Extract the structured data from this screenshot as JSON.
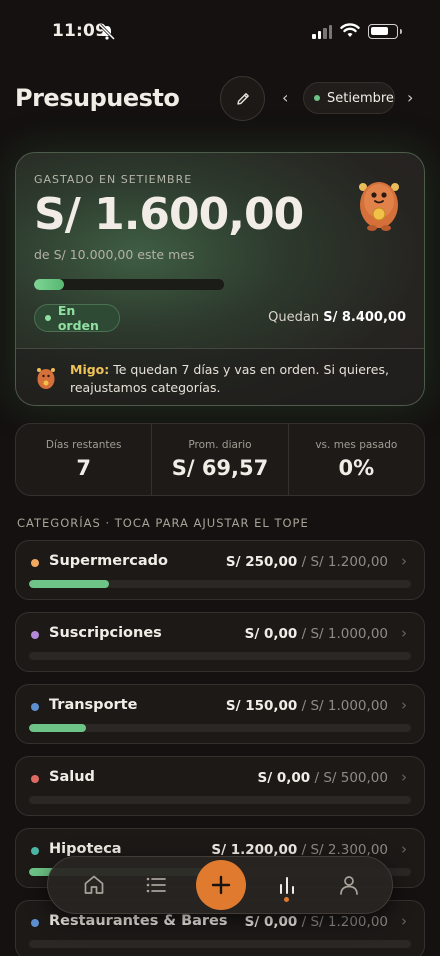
{
  "status": {
    "time": "11:09"
  },
  "header": {
    "title": "Presupuesto",
    "month": "Setiembre",
    "prev": "‹",
    "next": "›"
  },
  "summary": {
    "label": "GASTADO EN SETIEMBRE",
    "amount": "S/ 1.600,00",
    "of_total": "de S/ 10.000,00 este mes",
    "progress": 0.16,
    "status": "En orden",
    "remaining_label": "Quedan",
    "remaining_value": "S/ 8.400,00",
    "migo_name": "Migo:",
    "migo_message": "Te quedan 7 días y vas en orden. Si quieres, reajustamos categorías."
  },
  "stats": [
    {
      "label": "Días restantes",
      "value": "7"
    },
    {
      "label": "Prom. diario",
      "value": "S/ 69,57"
    },
    {
      "label": "vs. mes pasado",
      "value": "0%"
    }
  ],
  "section_title": "CATEGORÍAS · TOCA PARA AJUSTAR EL TOPE",
  "categories": [
    {
      "name": "Supermercado",
      "spent": "S/ 250,00",
      "limit": "/ S/ 1.200,00",
      "color": "#f2a861",
      "progress": 0.21
    },
    {
      "name": "Suscripciones",
      "spent": "S/ 0,00",
      "limit": "/ S/ 1.000,00",
      "color": "#b48ad8",
      "progress": 0
    },
    {
      "name": "Transporte",
      "spent": "S/ 150,00",
      "limit": "/ S/ 1.000,00",
      "color": "#5d8fd0",
      "progress": 0.15
    },
    {
      "name": "Salud",
      "spent": "S/ 0,00",
      "limit": "/ S/ 500,00",
      "color": "#dc6a63",
      "progress": 0
    },
    {
      "name": "Hipoteca",
      "spent": "S/ 1.200,00",
      "limit": "/ S/ 2.300,00",
      "color": "#4bb5a3",
      "progress": 0.52
    },
    {
      "name": "Restaurantes & Bares",
      "spent": "S/ 0,00",
      "limit": "/ S/ 1.200,00",
      "color": "#5d8fd0",
      "progress": 0
    }
  ],
  "nav": {
    "items": [
      "home-icon",
      "list-icon",
      "add-icon",
      "stats-icon",
      "profile-icon"
    ],
    "active": "stats-icon",
    "accent": "#e07a2e"
  },
  "colors": {
    "accent_green": "#6dc486",
    "accent_orange": "#e07a2e",
    "background": "#141110"
  }
}
